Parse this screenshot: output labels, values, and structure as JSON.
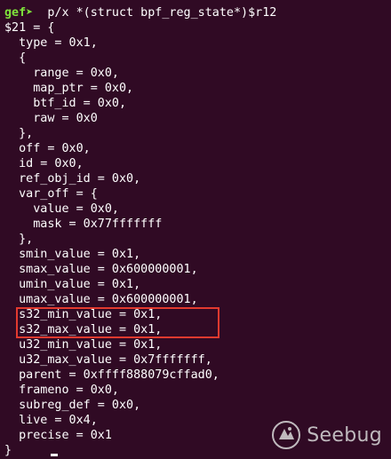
{
  "terminal": {
    "prompt": "gef➤",
    "command": "  p/x *(struct bpf_reg_state*)$r12",
    "lines": [
      "$21 = {",
      "  type = 0x1,",
      "  {",
      "    range = 0x0,",
      "    map_ptr = 0x0,",
      "    btf_id = 0x0,",
      "    raw = 0x0",
      "  },",
      "  off = 0x0,",
      "  id = 0x0,",
      "  ref_obj_id = 0x0,",
      "  var_off = {",
      "    value = 0x0,",
      "    mask = 0x77fffffff",
      "  },",
      "  smin_value = 0x1,",
      "  smax_value = 0x600000001,",
      "  umin_value = 0x1,",
      "  umax_value = 0x600000001,",
      "  s32_min_value = 0x1,",
      "  s32_max_value = 0x1,",
      "  u32_min_value = 0x1,",
      "  u32_max_value = 0x7fffffff,",
      "  parent = 0xffff888079cffad0,",
      "  frameno = 0x0,",
      "  subreg_def = 0x0,",
      "  live = 0x4,",
      "  precise = 0x1",
      "}"
    ]
  },
  "watermark": {
    "text": "Seebug",
    "icon": "seebug-logo-icon"
  },
  "colors": {
    "background": "#300a24",
    "prompt": "#7fe33b",
    "text": "#ffffff",
    "highlight": "#e23a2f"
  }
}
